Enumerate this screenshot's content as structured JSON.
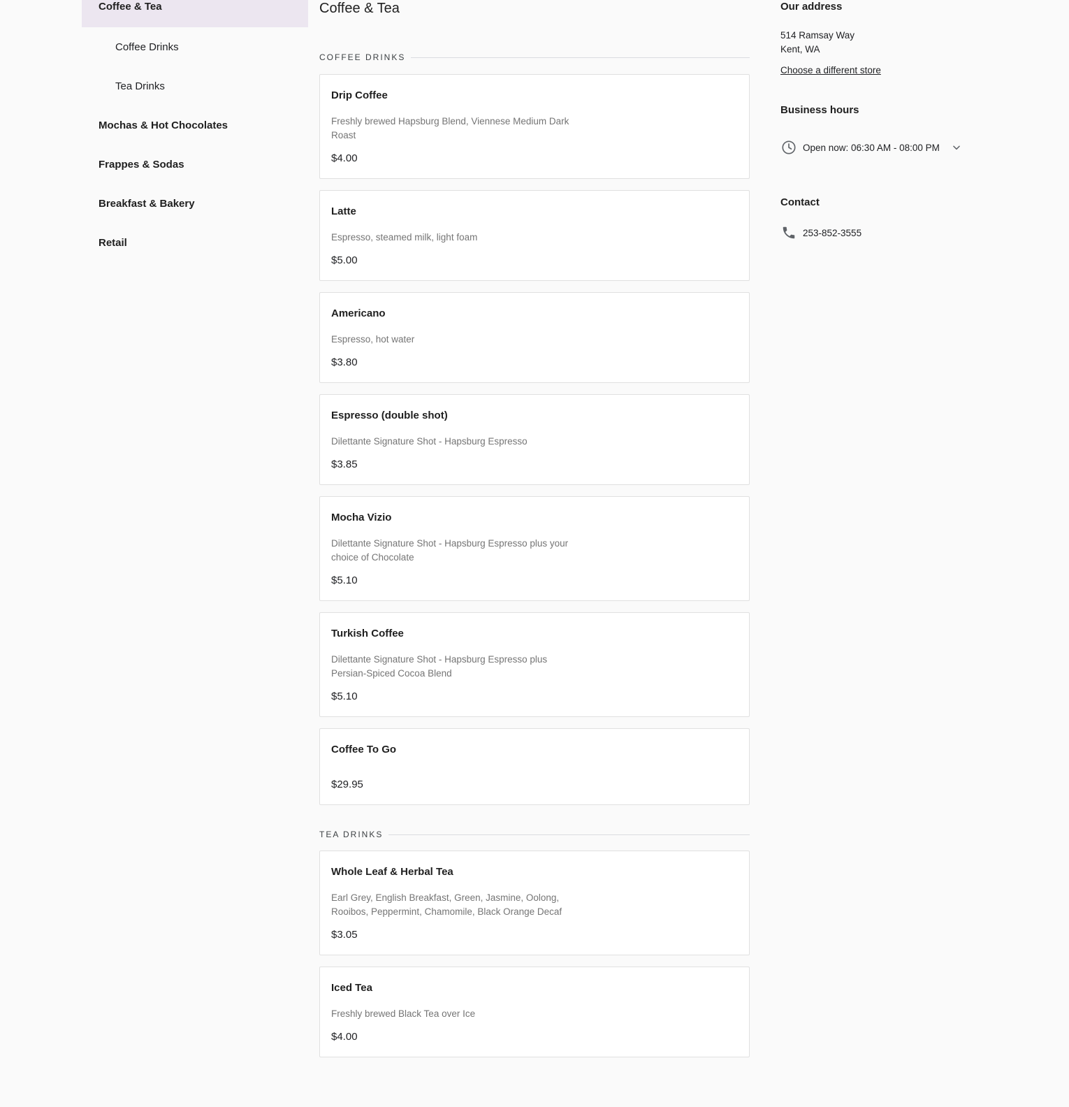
{
  "nav": {
    "items": [
      {
        "label": "Coffee & Tea"
      },
      {
        "label": "Coffee Drinks"
      },
      {
        "label": "Tea Drinks"
      },
      {
        "label": "Mochas & Hot Chocolates"
      },
      {
        "label": "Frappes & Sodas"
      },
      {
        "label": "Breakfast & Bakery"
      },
      {
        "label": "Retail"
      }
    ]
  },
  "main": {
    "title": "Coffee & Tea",
    "sections": [
      {
        "heading": "COFFEE DRINKS",
        "items": [
          {
            "name": "Drip Coffee",
            "description": "Freshly brewed Hapsburg Blend, Viennese Medium Dark Roast",
            "price": "$4.00"
          },
          {
            "name": "Latte",
            "description": "Espresso, steamed milk, light foam",
            "price": "$5.00"
          },
          {
            "name": "Americano",
            "description": "Espresso, hot water",
            "price": "$3.80"
          },
          {
            "name": "Espresso (double shot)",
            "description": "Dilettante Signature Shot - Hapsburg Espresso",
            "price": "$3.85"
          },
          {
            "name": "Mocha Vizio",
            "description": "Dilettante Signature Shot - Hapsburg Espresso plus your choice of Chocolate",
            "price": "$5.10"
          },
          {
            "name": "Turkish Coffee",
            "description": "Dilettante Signature Shot - Hapsburg Espresso plus Persian-Spiced Cocoa Blend",
            "price": "$5.10"
          },
          {
            "name": "Coffee To Go",
            "description": "",
            "price": "$29.95"
          }
        ]
      },
      {
        "heading": "TEA DRINKS",
        "items": [
          {
            "name": "Whole Leaf & Herbal Tea",
            "description": "Earl Grey, English Breakfast, Green, Jasmine, Oolong, Rooibos, Peppermint, Chamomile, Black Orange Decaf",
            "price": "$3.05"
          },
          {
            "name": "Iced Tea",
            "description": "Freshly brewed Black Tea over Ice",
            "price": "$4.00"
          }
        ]
      }
    ]
  },
  "info": {
    "address": {
      "heading": "Our address",
      "line1": "514 Ramsay Way",
      "line2": "Kent, WA",
      "change_link": "Choose a different store"
    },
    "hours": {
      "heading": "Business hours",
      "status": "Open now: 06:30 AM - 08:00 PM",
      "icon": "clock-icon"
    },
    "contact": {
      "heading": "Contact",
      "phone": "253-852-3555",
      "icon": "phone-icon"
    }
  },
  "colors": {
    "active_nav_bg": "#ece6f0",
    "page_bg": "#fafafa",
    "card_border": "#e0e0e0",
    "muted_text": "#757575"
  }
}
